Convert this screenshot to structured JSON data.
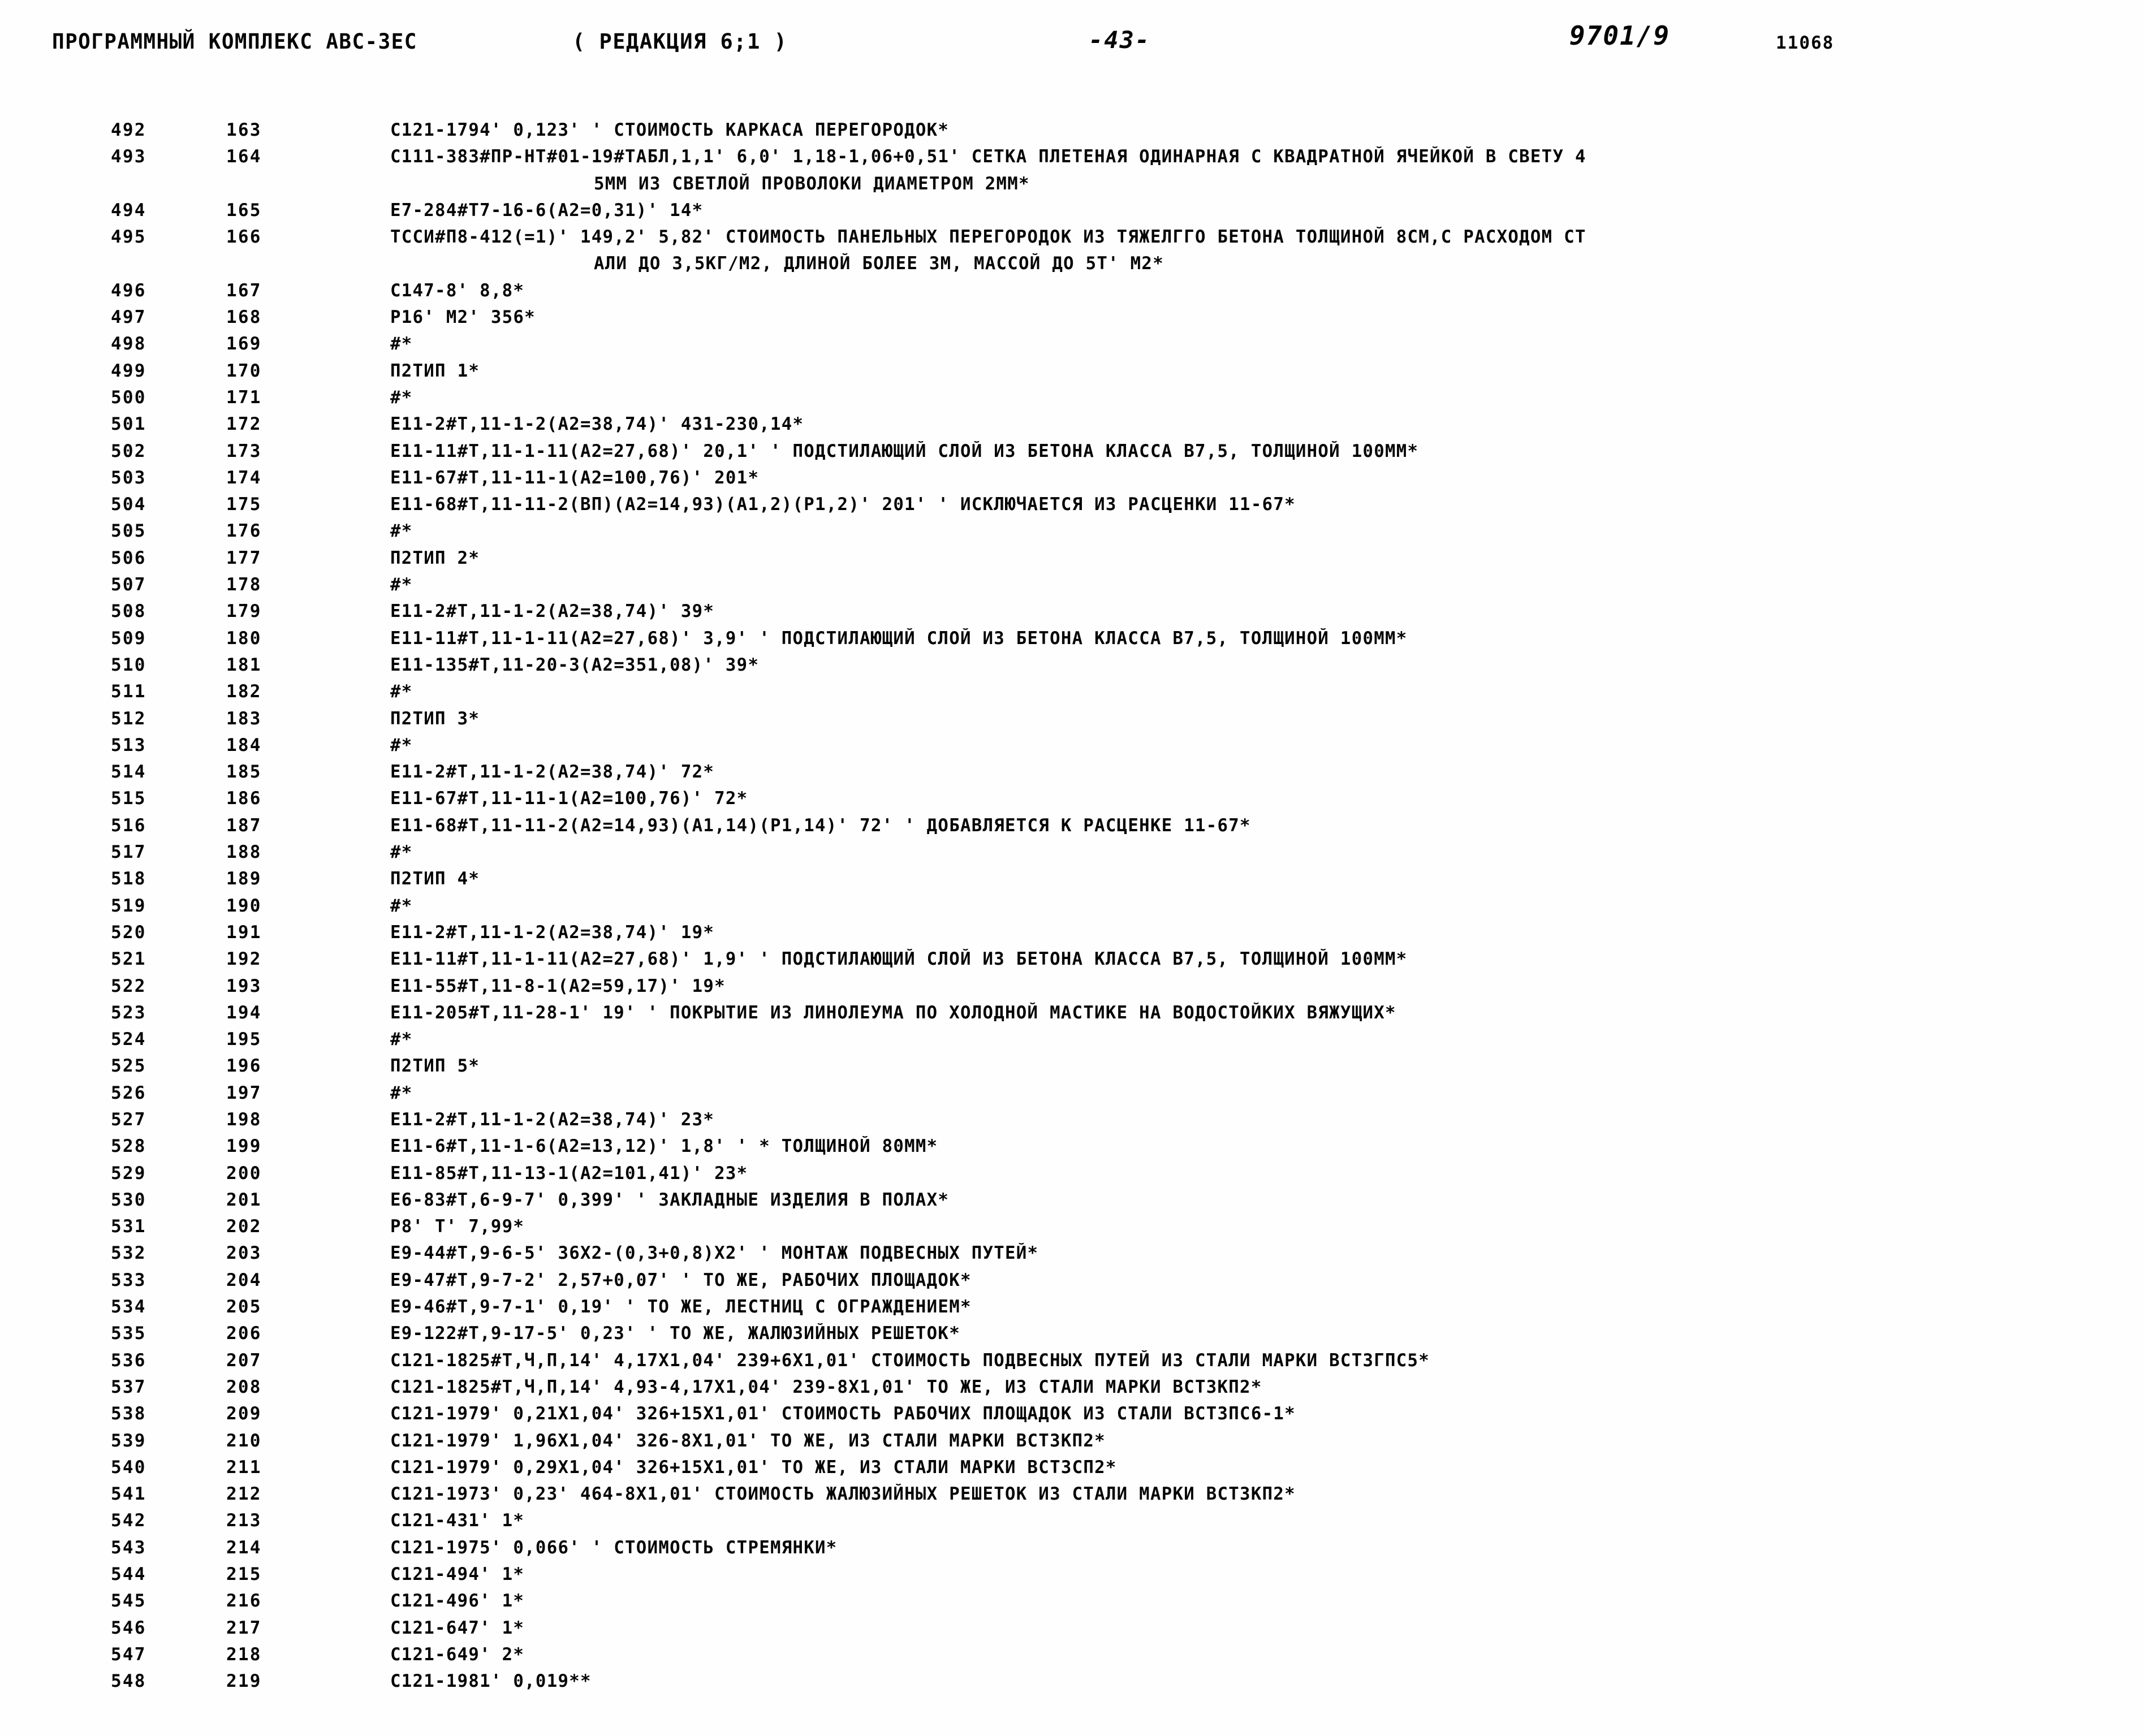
{
  "header": {
    "title": "ПРОГРАММНЫЙ КОМПЛЕКС АВС-ЗЕС",
    "edition": "( РЕДАКЦИЯ  6;1 )",
    "page_number": "-43-",
    "code": "9701/9",
    "doc_number": "11068"
  },
  "listing": {
    "rows": [
      {
        "seq": "492",
        "num": "163",
        "text": "C121-1794' 0,123' ' СТОИМОСТЬ КАРКАСА ПЕРЕГОРОДОК*",
        "cont": false
      },
      {
        "seq": "493",
        "num": "164",
        "text": "C111-383#ПР-НТ#01-19#ТАБЛ,1,1' 6,0' 1,18-1,06+0,51' СЕТКА ПЛЕТЕНАЯ ОДИНАРНАЯ С КВАДРАТНОЙ ЯЧЕЙКОЙ В СВЕТУ 4",
        "cont": false
      },
      {
        "seq": "",
        "num": "",
        "text": "5ММ ИЗ СВЕТЛОЙ ПРОВОЛОКИ ДИАМЕТРОМ 2ММ*",
        "cont": true
      },
      {
        "seq": "494",
        "num": "165",
        "text": "E7-284#T7-16-6(A2=0,31)' 14*",
        "cont": false
      },
      {
        "seq": "495",
        "num": "166",
        "text": "ТССИ#П8-412(=1)' 149,2' 5,82' СТОИМОСТЬ ПАНЕЛЬНЫХ ПЕРЕГОРОДОК ИЗ ТЯЖЕЛГГО БЕТОНА ТОЛЩИНОЙ 8СМ,С РАСХОДОМ СТ",
        "cont": false
      },
      {
        "seq": "",
        "num": "",
        "text": "АЛИ ДО 3,5КГ/М2, ДЛИНОЙ БОЛЕЕ 3М, МАССОЙ ДО 5Т' М2*",
        "cont": true
      },
      {
        "seq": "496",
        "num": "167",
        "text": "C147-8' 8,8*",
        "cont": false
      },
      {
        "seq": "497",
        "num": "168",
        "text": "P16' M2' 356*",
        "cont": false
      },
      {
        "seq": "498",
        "num": "169",
        "text": "#*",
        "cont": false
      },
      {
        "seq": "499",
        "num": "170",
        "text": "П2ТИП 1*",
        "cont": false
      },
      {
        "seq": "500",
        "num": "171",
        "text": "#*",
        "cont": false
      },
      {
        "seq": "501",
        "num": "172",
        "text": "E11-2#T,11-1-2(A2=38,74)' 431-230,14*",
        "cont": false
      },
      {
        "seq": "502",
        "num": "173",
        "text": "E11-11#T,11-1-11(A2=27,68)' 20,1' ' ПОДСТИЛАЮЩИЙ СЛОЙ ИЗ БЕТОНА КЛАССА В7,5, ТОЛЩИНОЙ 100ММ*",
        "cont": false
      },
      {
        "seq": "503",
        "num": "174",
        "text": "E11-67#T,11-11-1(A2=100,76)' 201*",
        "cont": false
      },
      {
        "seq": "504",
        "num": "175",
        "text": "E11-68#T,11-11-2(ВП)(A2=14,93)(A1,2)(P1,2)' 201' ' ИСКЛЮЧАЕТСЯ ИЗ РАСЦЕНКИ 11-67*",
        "cont": false
      },
      {
        "seq": "505",
        "num": "176",
        "text": "#*",
        "cont": false
      },
      {
        "seq": "506",
        "num": "177",
        "text": "П2ТИП 2*",
        "cont": false
      },
      {
        "seq": "507",
        "num": "178",
        "text": "#*",
        "cont": false
      },
      {
        "seq": "508",
        "num": "179",
        "text": "E11-2#T,11-1-2(A2=38,74)' 39*",
        "cont": false
      },
      {
        "seq": "509",
        "num": "180",
        "text": "E11-11#T,11-1-11(A2=27,68)' 3,9' ' ПОДСТИЛАЮЩИЙ СЛОЙ ИЗ БЕТОНА КЛАССА В7,5, ТОЛЩИНОЙ 100ММ*",
        "cont": false
      },
      {
        "seq": "510",
        "num": "181",
        "text": "E11-135#T,11-20-3(A2=351,08)' 39*",
        "cont": false
      },
      {
        "seq": "511",
        "num": "182",
        "text": "#*",
        "cont": false
      },
      {
        "seq": "512",
        "num": "183",
        "text": "П2ТИП 3*",
        "cont": false
      },
      {
        "seq": "513",
        "num": "184",
        "text": "#*",
        "cont": false
      },
      {
        "seq": "514",
        "num": "185",
        "text": "E11-2#T,11-1-2(A2=38,74)' 72*",
        "cont": false
      },
      {
        "seq": "515",
        "num": "186",
        "text": "E11-67#T,11-11-1(A2=100,76)' 72*",
        "cont": false
      },
      {
        "seq": "516",
        "num": "187",
        "text": "E11-68#T,11-11-2(A2=14,93)(A1,14)(P1,14)' 72' ' ДОБАВЛЯЕТСЯ К РАСЦЕНКЕ 11-67*",
        "cont": false
      },
      {
        "seq": "517",
        "num": "188",
        "text": "#*",
        "cont": false
      },
      {
        "seq": "518",
        "num": "189",
        "text": "П2ТИП 4*",
        "cont": false
      },
      {
        "seq": "519",
        "num": "190",
        "text": "#*",
        "cont": false
      },
      {
        "seq": "520",
        "num": "191",
        "text": "E11-2#T,11-1-2(A2=38,74)' 19*",
        "cont": false
      },
      {
        "seq": "521",
        "num": "192",
        "text": "E11-11#T,11-1-11(A2=27,68)' 1,9' ' ПОДСТИЛАЮЩИЙ СЛОЙ ИЗ БЕТОНА КЛАССА В7,5, ТОЛЩИНОЙ 100ММ*",
        "cont": false
      },
      {
        "seq": "522",
        "num": "193",
        "text": "E11-55#T,11-8-1(A2=59,17)' 19*",
        "cont": false
      },
      {
        "seq": "523",
        "num": "194",
        "text": "E11-205#T,11-28-1' 19' ' ПОКРЫТИЕ ИЗ ЛИНОЛЕУМА ПО ХОЛОДНОЙ МАСТИКЕ НА ВОДОСТОЙКИХ ВЯЖУЩИХ*",
        "cont": false
      },
      {
        "seq": "524",
        "num": "195",
        "text": "#*",
        "cont": false
      },
      {
        "seq": "525",
        "num": "196",
        "text": "П2ТИП 5*",
        "cont": false
      },
      {
        "seq": "526",
        "num": "197",
        "text": "#*",
        "cont": false
      },
      {
        "seq": "527",
        "num": "198",
        "text": "E11-2#T,11-1-2(A2=38,74)' 23*",
        "cont": false
      },
      {
        "seq": "528",
        "num": "199",
        "text": "E11-6#T,11-1-6(A2=13,12)' 1,8' ' * ТОЛЩИНОЙ 80ММ*",
        "cont": false
      },
      {
        "seq": "529",
        "num": "200",
        "text": "E11-85#T,11-13-1(A2=101,41)' 23*",
        "cont": false
      },
      {
        "seq": "530",
        "num": "201",
        "text": "E6-83#T,6-9-7' 0,399' ' ЗАКЛАДНЫЕ ИЗДЕЛИЯ В ПОЛАХ*",
        "cont": false
      },
      {
        "seq": "531",
        "num": "202",
        "text": "P8' T' 7,99*",
        "cont": false
      },
      {
        "seq": "532",
        "num": "203",
        "text": "E9-44#T,9-6-5' 36X2-(0,3+0,8)X2' ' МОНТАЖ ПОДВЕСНЫХ ПУТЕЙ*",
        "cont": false
      },
      {
        "seq": "533",
        "num": "204",
        "text": "E9-47#T,9-7-2' 2,57+0,07' ' ТО ЖЕ, РАБОЧИХ ПЛОЩАДОК*",
        "cont": false
      },
      {
        "seq": "534",
        "num": "205",
        "text": "E9-46#T,9-7-1' 0,19' ' ТО ЖЕ, ЛЕСТНИЦ С ОГРАЖДЕНИЕМ*",
        "cont": false
      },
      {
        "seq": "535",
        "num": "206",
        "text": "E9-122#T,9-17-5' 0,23' ' ТО ЖЕ, ЖАЛЮЗИЙНЫХ РЕШЕТОК*",
        "cont": false
      },
      {
        "seq": "536",
        "num": "207",
        "text": "C121-1825#T,Ч,П,14' 4,17X1,04' 239+6X1,01' СТОИМОСТЬ ПОДВЕСНЫХ ПУТЕЙ ИЗ СТАЛИ МАРКИ ВСТ3ГПС5*",
        "cont": false
      },
      {
        "seq": "537",
        "num": "208",
        "text": "C121-1825#T,Ч,П,14' 4,93-4,17X1,04' 239-8X1,01' ТО ЖЕ, ИЗ СТАЛИ МАРКИ ВСТ3КП2*",
        "cont": false
      },
      {
        "seq": "538",
        "num": "209",
        "text": "C121-1979' 0,21X1,04' 326+15X1,01' СТОИМОСТЬ РАБОЧИХ ПЛОЩАДОК ИЗ СТАЛИ ВСТ3ПС6-1*",
        "cont": false
      },
      {
        "seq": "539",
        "num": "210",
        "text": "C121-1979' 1,96X1,04' 326-8X1,01' ТО ЖЕ, ИЗ СТАЛИ МАРКИ ВСТ3КП2*",
        "cont": false
      },
      {
        "seq": "540",
        "num": "211",
        "text": "C121-1979' 0,29X1,04' 326+15X1,01' ТО ЖЕ, ИЗ СТАЛИ МАРКИ ВСТ3СП2*",
        "cont": false
      },
      {
        "seq": "541",
        "num": "212",
        "text": "C121-1973' 0,23' 464-8X1,01' СТОИМОСТЬ ЖАЛЮЗИЙНЫХ РЕШЕТОК ИЗ СТАЛИ МАРКИ ВСТ3КП2*",
        "cont": false
      },
      {
        "seq": "542",
        "num": "213",
        "text": "C121-431' 1*",
        "cont": false
      },
      {
        "seq": "543",
        "num": "214",
        "text": "C121-1975' 0,066' ' СТОИМОСТЬ СТРЕМЯНКИ*",
        "cont": false
      },
      {
        "seq": "544",
        "num": "215",
        "text": "C121-494' 1*",
        "cont": false
      },
      {
        "seq": "545",
        "num": "216",
        "text": "C121-496' 1*",
        "cont": false
      },
      {
        "seq": "546",
        "num": "217",
        "text": "C121-647' 1*",
        "cont": false
      },
      {
        "seq": "547",
        "num": "218",
        "text": "C121-649' 2*",
        "cont": false
      },
      {
        "seq": "548",
        "num": "219",
        "text": "C121-1981' 0,019**",
        "cont": false
      }
    ]
  }
}
